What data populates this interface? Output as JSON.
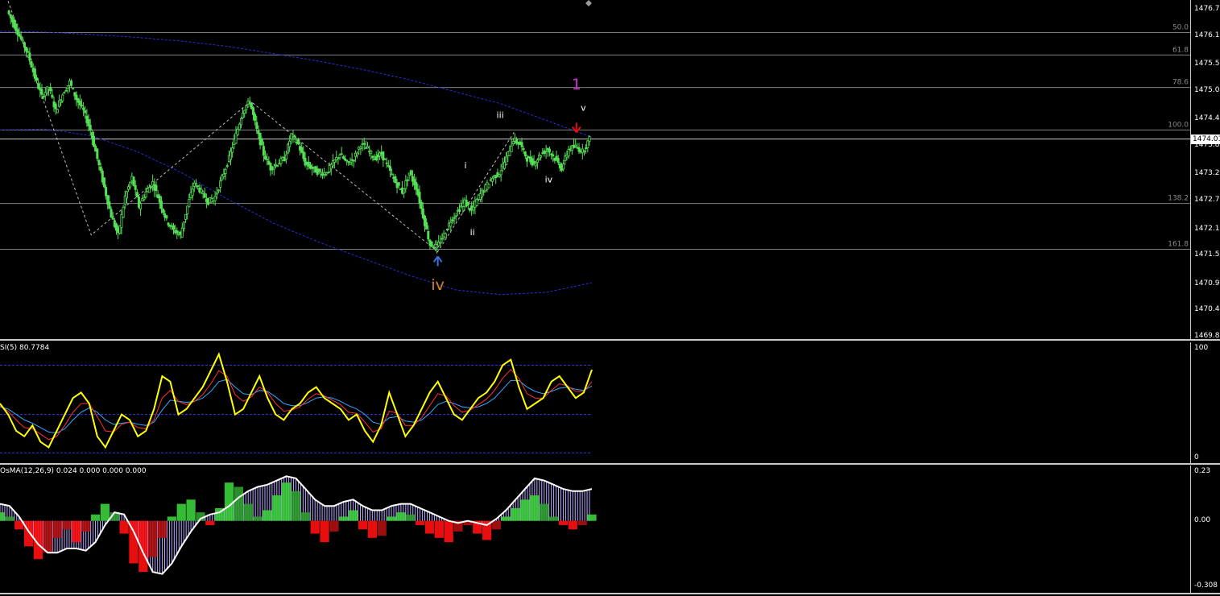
{
  "chart_data": [
    {
      "type": "candlestick",
      "panel": "price",
      "ylim": [
        1469.87,
        1476.72
      ],
      "y_ticks": [
        "1476.72",
        "1476.17",
        "1475.57",
        "1475.02",
        "1474.42",
        "1473.87",
        "1473.27",
        "1472.72",
        "1472.12",
        "1471.57",
        "1470.97",
        "1470.42",
        "1469.87"
      ],
      "current_price": "1474.01",
      "current_price_value": 1474.01,
      "fib_levels": [
        {
          "label": "50.0",
          "value": 1476.24
        },
        {
          "label": "61.8",
          "value": 1475.77
        },
        {
          "label": "78.6",
          "value": 1475.09
        },
        {
          "label": "100.0",
          "value": 1474.2
        },
        {
          "label": "138.2",
          "value": 1472.66
        },
        {
          "label": "161.8",
          "value": 1471.7
        }
      ],
      "close_path": [
        1476.7,
        1476.4,
        1476.1,
        1475.8,
        1475.3,
        1474.9,
        1475.1,
        1474.6,
        1474.95,
        1475.2,
        1474.85,
        1474.6,
        1474.2,
        1473.6,
        1473.0,
        1472.4,
        1472.0,
        1472.8,
        1473.2,
        1472.6,
        1472.9,
        1473.1,
        1472.7,
        1472.3,
        1472.1,
        1472.0,
        1472.6,
        1473.1,
        1472.9,
        1472.7,
        1472.8,
        1473.2,
        1473.6,
        1474.1,
        1474.6,
        1474.8,
        1474.2,
        1473.7,
        1473.4,
        1473.5,
        1473.6,
        1474.1,
        1473.9,
        1473.5,
        1473.4,
        1473.3,
        1473.3,
        1473.5,
        1473.7,
        1473.5,
        1473.6,
        1473.9,
        1473.8,
        1473.6,
        1473.7,
        1473.4,
        1473.1,
        1472.9,
        1473.3,
        1473.0,
        1472.4,
        1471.8,
        1471.75,
        1472.0,
        1472.3,
        1472.5,
        1472.7,
        1472.5,
        1472.8,
        1473.0,
        1473.2,
        1473.3,
        1473.6,
        1474.0,
        1473.9,
        1473.6,
        1473.5,
        1473.7,
        1473.8,
        1473.6,
        1473.4,
        1473.8,
        1473.85,
        1473.75,
        1474.01
      ],
      "dashed_curves": [
        {
          "name": "upper-band",
          "points": [
            1476.27,
            1476.25,
            1476.2,
            1476.14,
            1476.06,
            1475.95,
            1475.8,
            1475.64,
            1475.46,
            1475.25,
            1475.0,
            1474.75,
            1474.4,
            1474.05
          ]
        },
        {
          "name": "lower-band",
          "points": [
            1474.2,
            1474.22,
            1474.08,
            1473.75,
            1473.3,
            1472.75,
            1472.25,
            1471.85,
            1471.5,
            1471.15,
            1470.85,
            1470.75,
            1470.8,
            1471.0
          ]
        }
      ],
      "zigzag": [
        [
          0,
          1476.9
        ],
        [
          12,
          1472.0
        ],
        [
          35,
          1474.8
        ],
        [
          62,
          1471.65
        ],
        [
          73,
          1474.15
        ]
      ],
      "wave_labels": [
        {
          "text": "iv",
          "index": 62,
          "value": 1470.85,
          "color": "#d4861c",
          "size": "large"
        },
        {
          "text": "i",
          "index": 66,
          "value": 1473.4,
          "color": "#ffffff",
          "size": "small"
        },
        {
          "text": "ii",
          "index": 67,
          "value": 1472.0,
          "color": "#ffffff",
          "size": "small"
        },
        {
          "text": "iii",
          "index": 71,
          "value": 1474.45,
          "color": "#ffffff",
          "size": "small"
        },
        {
          "text": "iv",
          "index": 78,
          "value": 1473.1,
          "color": "#ffffff",
          "size": "small"
        },
        {
          "text": "v",
          "index": 83,
          "value": 1474.6,
          "color": "#ffffff",
          "size": "small"
        },
        {
          "text": "1",
          "index": 82,
          "value": 1475.05,
          "color": "#c832c8",
          "size": "large"
        }
      ],
      "arrows": [
        {
          "direction": "up",
          "index": 62,
          "value": 1471.45,
          "color": "#3b6fe0"
        },
        {
          "direction": "down",
          "index": 82,
          "value": 1474.25,
          "color": "#e01010"
        }
      ],
      "colors": {
        "candle": "#55e055",
        "band": "#2b2bd6",
        "zigzag": "#bfbfbf",
        "grid": "#b4b4b4"
      }
    },
    {
      "type": "line",
      "panel": "rsi",
      "label": "SI(5) 80.7784",
      "ylim": [
        0,
        100
      ],
      "y_ticks": [
        "100",
        "0"
      ],
      "levels": [
        85,
        40,
        5
      ],
      "series": [
        {
          "name": "RSI(5)",
          "color": "#ffff00",
          "values": [
            50,
            40,
            25,
            20,
            30,
            15,
            10,
            25,
            40,
            55,
            60,
            50,
            20,
            10,
            25,
            40,
            35,
            20,
            25,
            45,
            75,
            70,
            40,
            45,
            55,
            65,
            80,
            95,
            70,
            40,
            45,
            60,
            75,
            55,
            40,
            35,
            45,
            50,
            60,
            65,
            55,
            50,
            45,
            35,
            40,
            25,
            15,
            30,
            60,
            40,
            20,
            30,
            45,
            60,
            70,
            55,
            40,
            35,
            45,
            55,
            60,
            70,
            85,
            90,
            65,
            45,
            50,
            55,
            70,
            75,
            65,
            55,
            60,
            80.78
          ]
        },
        {
          "name": "Signal Fast",
          "color": "#ff3030",
          "values": [
            48,
            43,
            35,
            28,
            27,
            22,
            17,
            20,
            30,
            42,
            50,
            50,
            38,
            25,
            24,
            31,
            33,
            28,
            27,
            35,
            55,
            62,
            52,
            49,
            52,
            58,
            68,
            80,
            75,
            58,
            52,
            56,
            65,
            60,
            50,
            43,
            44,
            47,
            54,
            59,
            57,
            53,
            49,
            42,
            41,
            33,
            24,
            27,
            43,
            41,
            30,
            30,
            37,
            48,
            59,
            57,
            48,
            42,
            44,
            49,
            54,
            62,
            73,
            81,
            73,
            59,
            55,
            55,
            62,
            68,
            66,
            61,
            61,
            70
          ]
        },
        {
          "name": "Signal Slow",
          "color": "#30a8ff",
          "values": [
            47,
            45,
            40,
            35,
            32,
            28,
            24,
            23,
            27,
            35,
            42,
            46,
            42,
            35,
            31,
            32,
            33,
            31,
            30,
            33,
            44,
            53,
            52,
            51,
            52,
            55,
            61,
            70,
            72,
            65,
            59,
            58,
            62,
            61,
            56,
            50,
            48,
            48,
            51,
            55,
            56,
            55,
            52,
            48,
            45,
            40,
            33,
            31,
            37,
            38,
            34,
            33,
            35,
            41,
            49,
            52,
            50,
            47,
            46,
            47,
            50,
            55,
            63,
            71,
            71,
            65,
            61,
            59,
            61,
            64,
            65,
            63,
            62,
            66
          ]
        }
      ]
    },
    {
      "type": "bar",
      "panel": "osma",
      "label": "OsMA(12,26,9) 0.024 0.000 0.000 0.000",
      "ylim": [
        -0.308,
        0.23
      ],
      "y_ticks": [
        "0.23",
        "0.00",
        "-0.308"
      ],
      "bar_colors": {
        "pos_rising": "#3ccf3c",
        "pos_falling": "#2e9e2e",
        "neg_falling": "#ff1010",
        "neg_rising": "#b01010",
        "macd_hist": "#b8a8ff",
        "line": "#ffffff"
      },
      "osma": [
        0.04,
        0.02,
        -0.04,
        -0.12,
        -0.18,
        -0.15,
        -0.08,
        -0.04,
        -0.1,
        -0.05,
        0.03,
        0.08,
        0.04,
        -0.06,
        -0.2,
        -0.24,
        -0.17,
        -0.08,
        0.02,
        0.08,
        0.1,
        0.04,
        -0.02,
        0.06,
        0.18,
        0.16,
        0.08,
        0.02,
        0.05,
        0.12,
        0.18,
        0.14,
        0.04,
        -0.06,
        -0.1,
        -0.05,
        0.02,
        0.05,
        -0.04,
        -0.08,
        -0.07,
        0.02,
        0.04,
        0.03,
        -0.02,
        -0.06,
        -0.08,
        -0.1,
        -0.05,
        -0.02,
        -0.06,
        -0.09,
        -0.04,
        0.02,
        0.06,
        0.1,
        0.12,
        0.08,
        0.02,
        -0.02,
        -0.04,
        -0.02,
        0.03
      ],
      "macd": [
        0.08,
        0.07,
        0.02,
        -0.05,
        -0.11,
        -0.15,
        -0.15,
        -0.13,
        -0.13,
        -0.14,
        -0.1,
        -0.02,
        0.04,
        0.03,
        -0.05,
        -0.15,
        -0.24,
        -0.25,
        -0.2,
        -0.12,
        -0.05,
        0.01,
        0.03,
        0.04,
        0.07,
        0.11,
        0.14,
        0.16,
        0.17,
        0.19,
        0.21,
        0.2,
        0.15,
        0.1,
        0.07,
        0.07,
        0.09,
        0.1,
        0.07,
        0.05,
        0.05,
        0.07,
        0.08,
        0.08,
        0.06,
        0.04,
        0.02,
        0.0,
        -0.01,
        0.0,
        -0.01,
        -0.02,
        0.01,
        0.05,
        0.1,
        0.15,
        0.2,
        0.19,
        0.17,
        0.15,
        0.14,
        0.14,
        0.15
      ]
    }
  ]
}
